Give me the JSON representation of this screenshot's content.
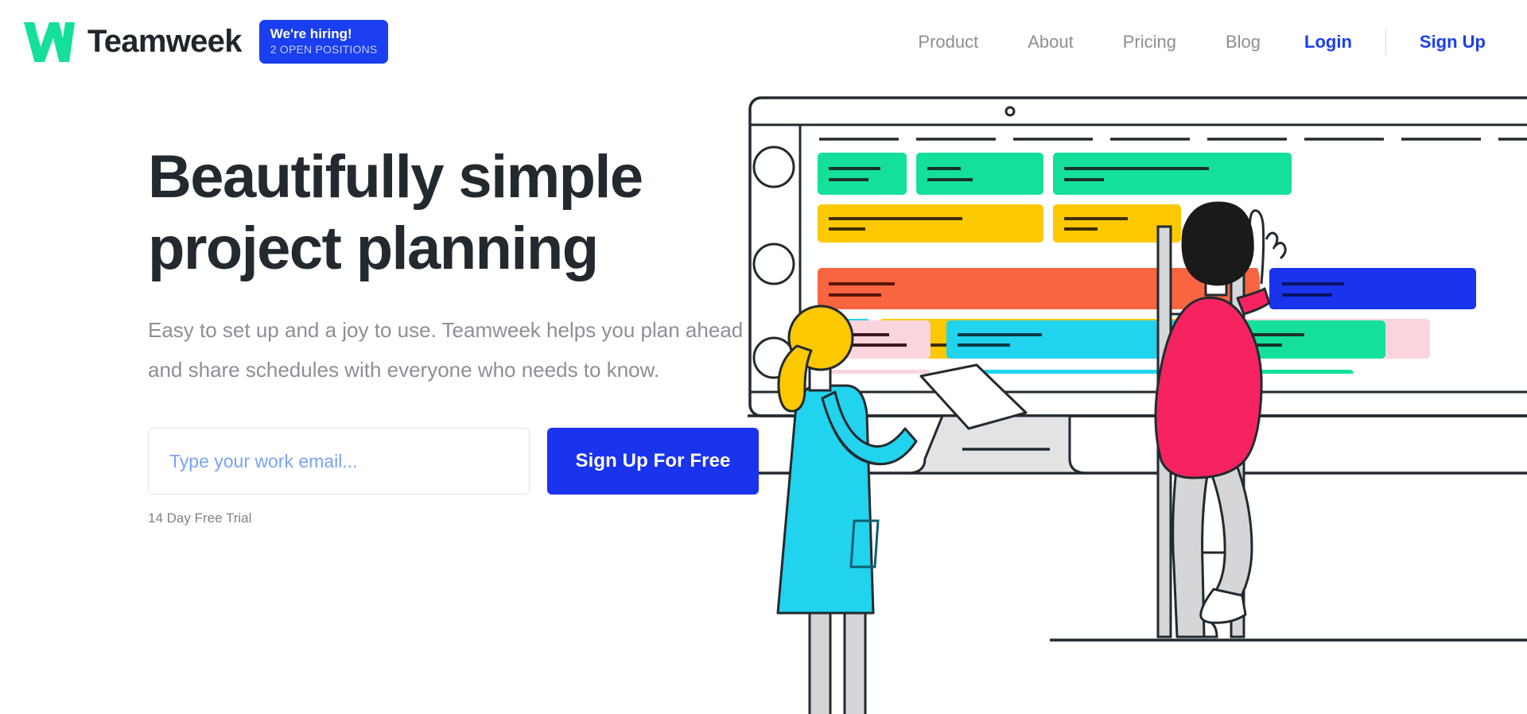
{
  "brand": {
    "name": "Teamweek",
    "logo_icon": "teamweek-w-logo-icon",
    "logo_color": "#14E09A"
  },
  "header": {
    "hiring_badge": {
      "title": "We're hiring!",
      "subtitle": "2 OPEN POSITIONS",
      "bg_color": "#1a3ef0"
    },
    "nav_links": [
      {
        "label": "Product"
      },
      {
        "label": "About"
      },
      {
        "label": "Pricing"
      },
      {
        "label": "Blog"
      }
    ],
    "login_label": "Login",
    "signup_label": "Sign Up",
    "link_color": "#1a3ef0",
    "nav_text_color": "#8a8f94"
  },
  "hero": {
    "headline_line1": "Beautifully simple",
    "headline_line2": "project planning",
    "subheadline": "Easy to set up and a joy to use. Teamweek helps you plan ahead and share schedules with everyone who needs to know.",
    "email_placeholder": "Type your work email...",
    "email_value": "",
    "cta_label": "Sign Up For Free",
    "trial_note": "14 Day Free Trial",
    "cta_color": "#1a33ed",
    "headline_color": "#232a2f",
    "subheadline_color": "#8b9096"
  },
  "illustration": {
    "name": "project-planning-monitor-illustration",
    "sticky_note_color": "#f9a8bd",
    "screen_rows": [
      {
        "avatar": "avatar-circle-1",
        "bars": [
          {
            "color": "#14e09a",
            "lines": 2
          },
          {
            "color": "#14e09a",
            "lines": 2
          },
          {
            "color": "#14e09a",
            "lines": 2
          }
        ]
      },
      {
        "avatar": "",
        "bars": [
          {
            "color": "#fcc800",
            "lines": 2
          },
          {
            "color": "#fcc800",
            "lines": 1
          }
        ]
      },
      {
        "avatar": "avatar-circle-2",
        "bars": [
          {
            "color": "#fa6541",
            "lines": 2
          },
          {
            "color": "#1a33ed",
            "lines": 2
          }
        ]
      },
      {
        "avatar": "",
        "bars": [
          {
            "color": "#22d3ee",
            "lines": 2
          },
          {
            "color": "#fcc800",
            "lines": 2
          },
          {
            "color": "#fbd5dd",
            "lines": 2
          }
        ]
      },
      {
        "avatar": "avatar-circle-3",
        "bars": [
          {
            "color": "#fbd5dd",
            "lines": 2
          },
          {
            "color": "#22d3ee",
            "lines": 2
          },
          {
            "color": "#14e09a",
            "lines": 1
          }
        ]
      }
    ],
    "people": [
      {
        "name": "woman-with-document",
        "shirt_color": "#22d3ee",
        "hair_color": "#fcc800"
      },
      {
        "name": "man-on-ladder",
        "sweater_color": "#f72360",
        "hair_color": "#1a1a1a",
        "pants_color": "#d4d6d8"
      }
    ]
  }
}
